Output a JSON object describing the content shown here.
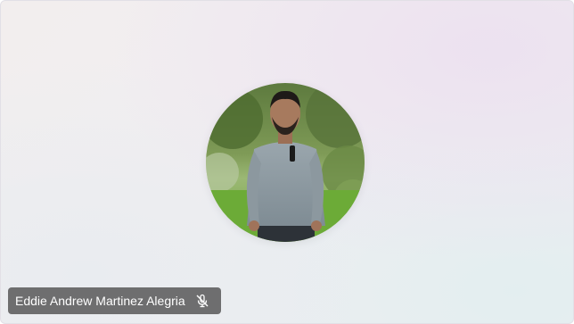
{
  "participant": {
    "name": "Eddie Andrew Martinez Alegria",
    "mic_status_icon": "mic-off-icon"
  },
  "colors": {
    "name_tag_background": "#5c5c5c",
    "name_tag_text": "#ffffff"
  }
}
